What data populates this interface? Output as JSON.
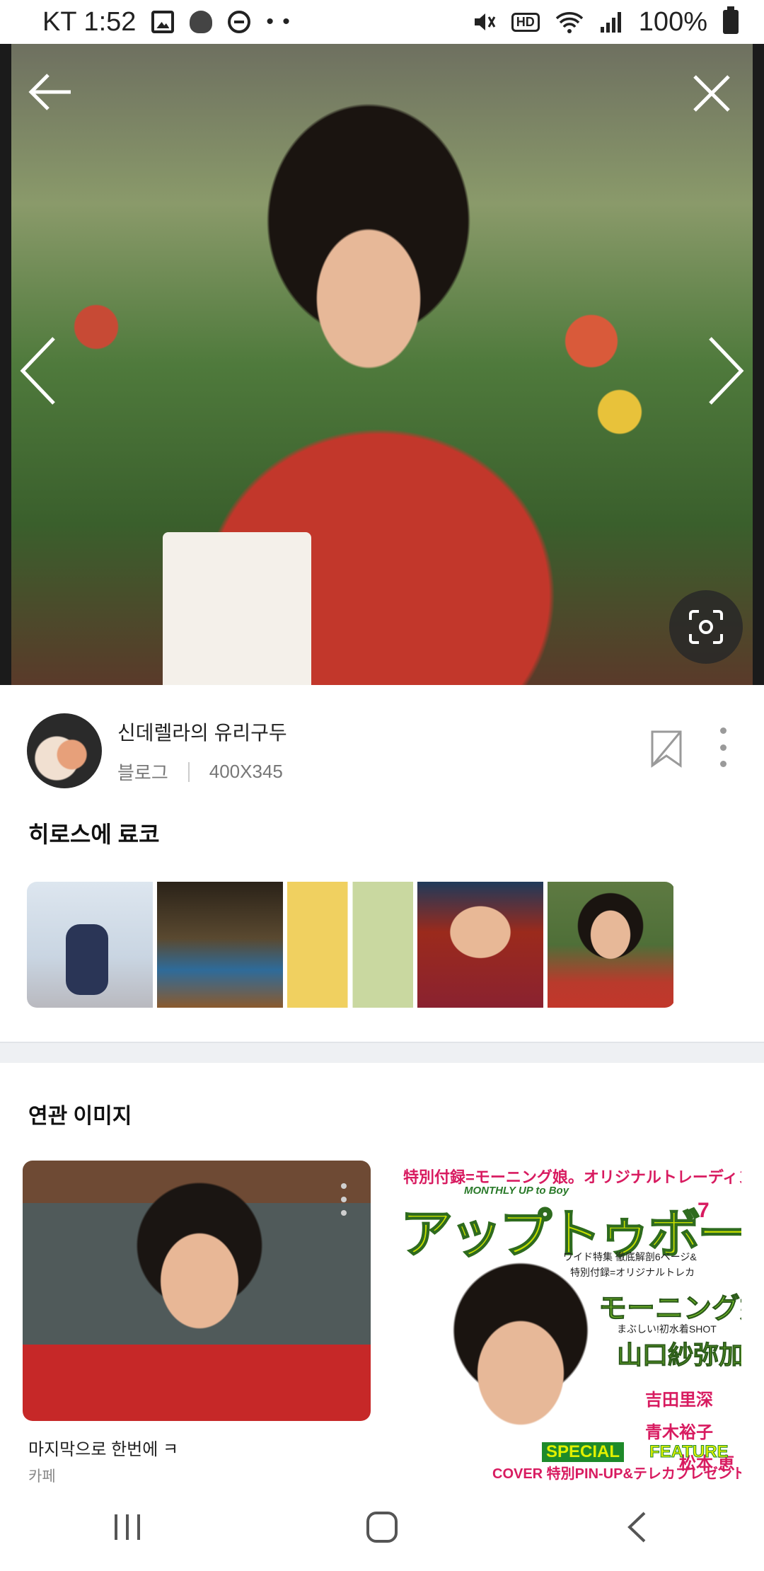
{
  "status_bar": {
    "carrier_time": "KT 1:52",
    "more_dots": "• •",
    "hd": "HD",
    "battery": "100%"
  },
  "viewer": {
    "source": {
      "name": "신데렐라의 유리구두",
      "type": "블로그",
      "dimensions": "400X345"
    },
    "image_title": "히로스에 료코",
    "thumbnails": [
      "thumbnail-1",
      "thumbnail-2",
      "thumbnail-3",
      "thumbnail-4",
      "thumbnail-5"
    ]
  },
  "related": {
    "title": "연관 이미지",
    "cards": [
      {
        "title": "마지막으로 한번에 ㅋ",
        "source": "카페"
      },
      {
        "title": "",
        "source": ""
      }
    ],
    "magazine_cover": {
      "top_banner": "特別付録=モーニング娘。オリジナルトレーディングカード!",
      "monthly": "MONTHLY  UP to Boy",
      "logo": "アップトゥボーイ",
      "issue": "7",
      "feature_line1": "ワイド特集  徹底解剖6ページ&",
      "feature_line2": "特別付録=オリジナルトレカ",
      "morning": "モーニング娘。",
      "shot": "まぶしい!初水着SHOT",
      "name1": "山口紗弥加",
      "name2": "吉田里深",
      "name3": "青木裕子",
      "name4": "松本 恵",
      "special": "SPECIAL",
      "feature": "FEATURE",
      "cover_line": "COVER 特別PIN-UP&テレカプレゼント!"
    }
  },
  "colors": {
    "divider": "#eef0f3",
    "hero_background": "#1b1b1b"
  }
}
